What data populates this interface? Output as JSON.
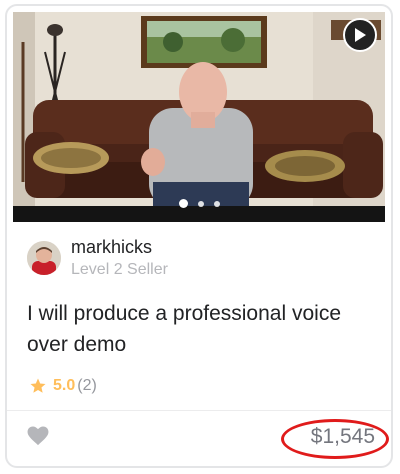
{
  "gig": {
    "title": "I will produce a professional voice over demo",
    "seller": {
      "username": "markhicks",
      "level": "Level 2 Seller"
    },
    "rating": {
      "score": "5.0",
      "count": "(2)"
    },
    "price": "$1,545"
  },
  "media": {
    "slides": 3,
    "active_slide": 1
  },
  "colors": {
    "star": "#ffbe5b",
    "annotation": "#e01b1b",
    "text_primary": "#222325",
    "text_muted": "#b5b6ba"
  },
  "icons": {
    "play": "play-icon",
    "star": "star-icon",
    "favorite": "heart-icon"
  }
}
